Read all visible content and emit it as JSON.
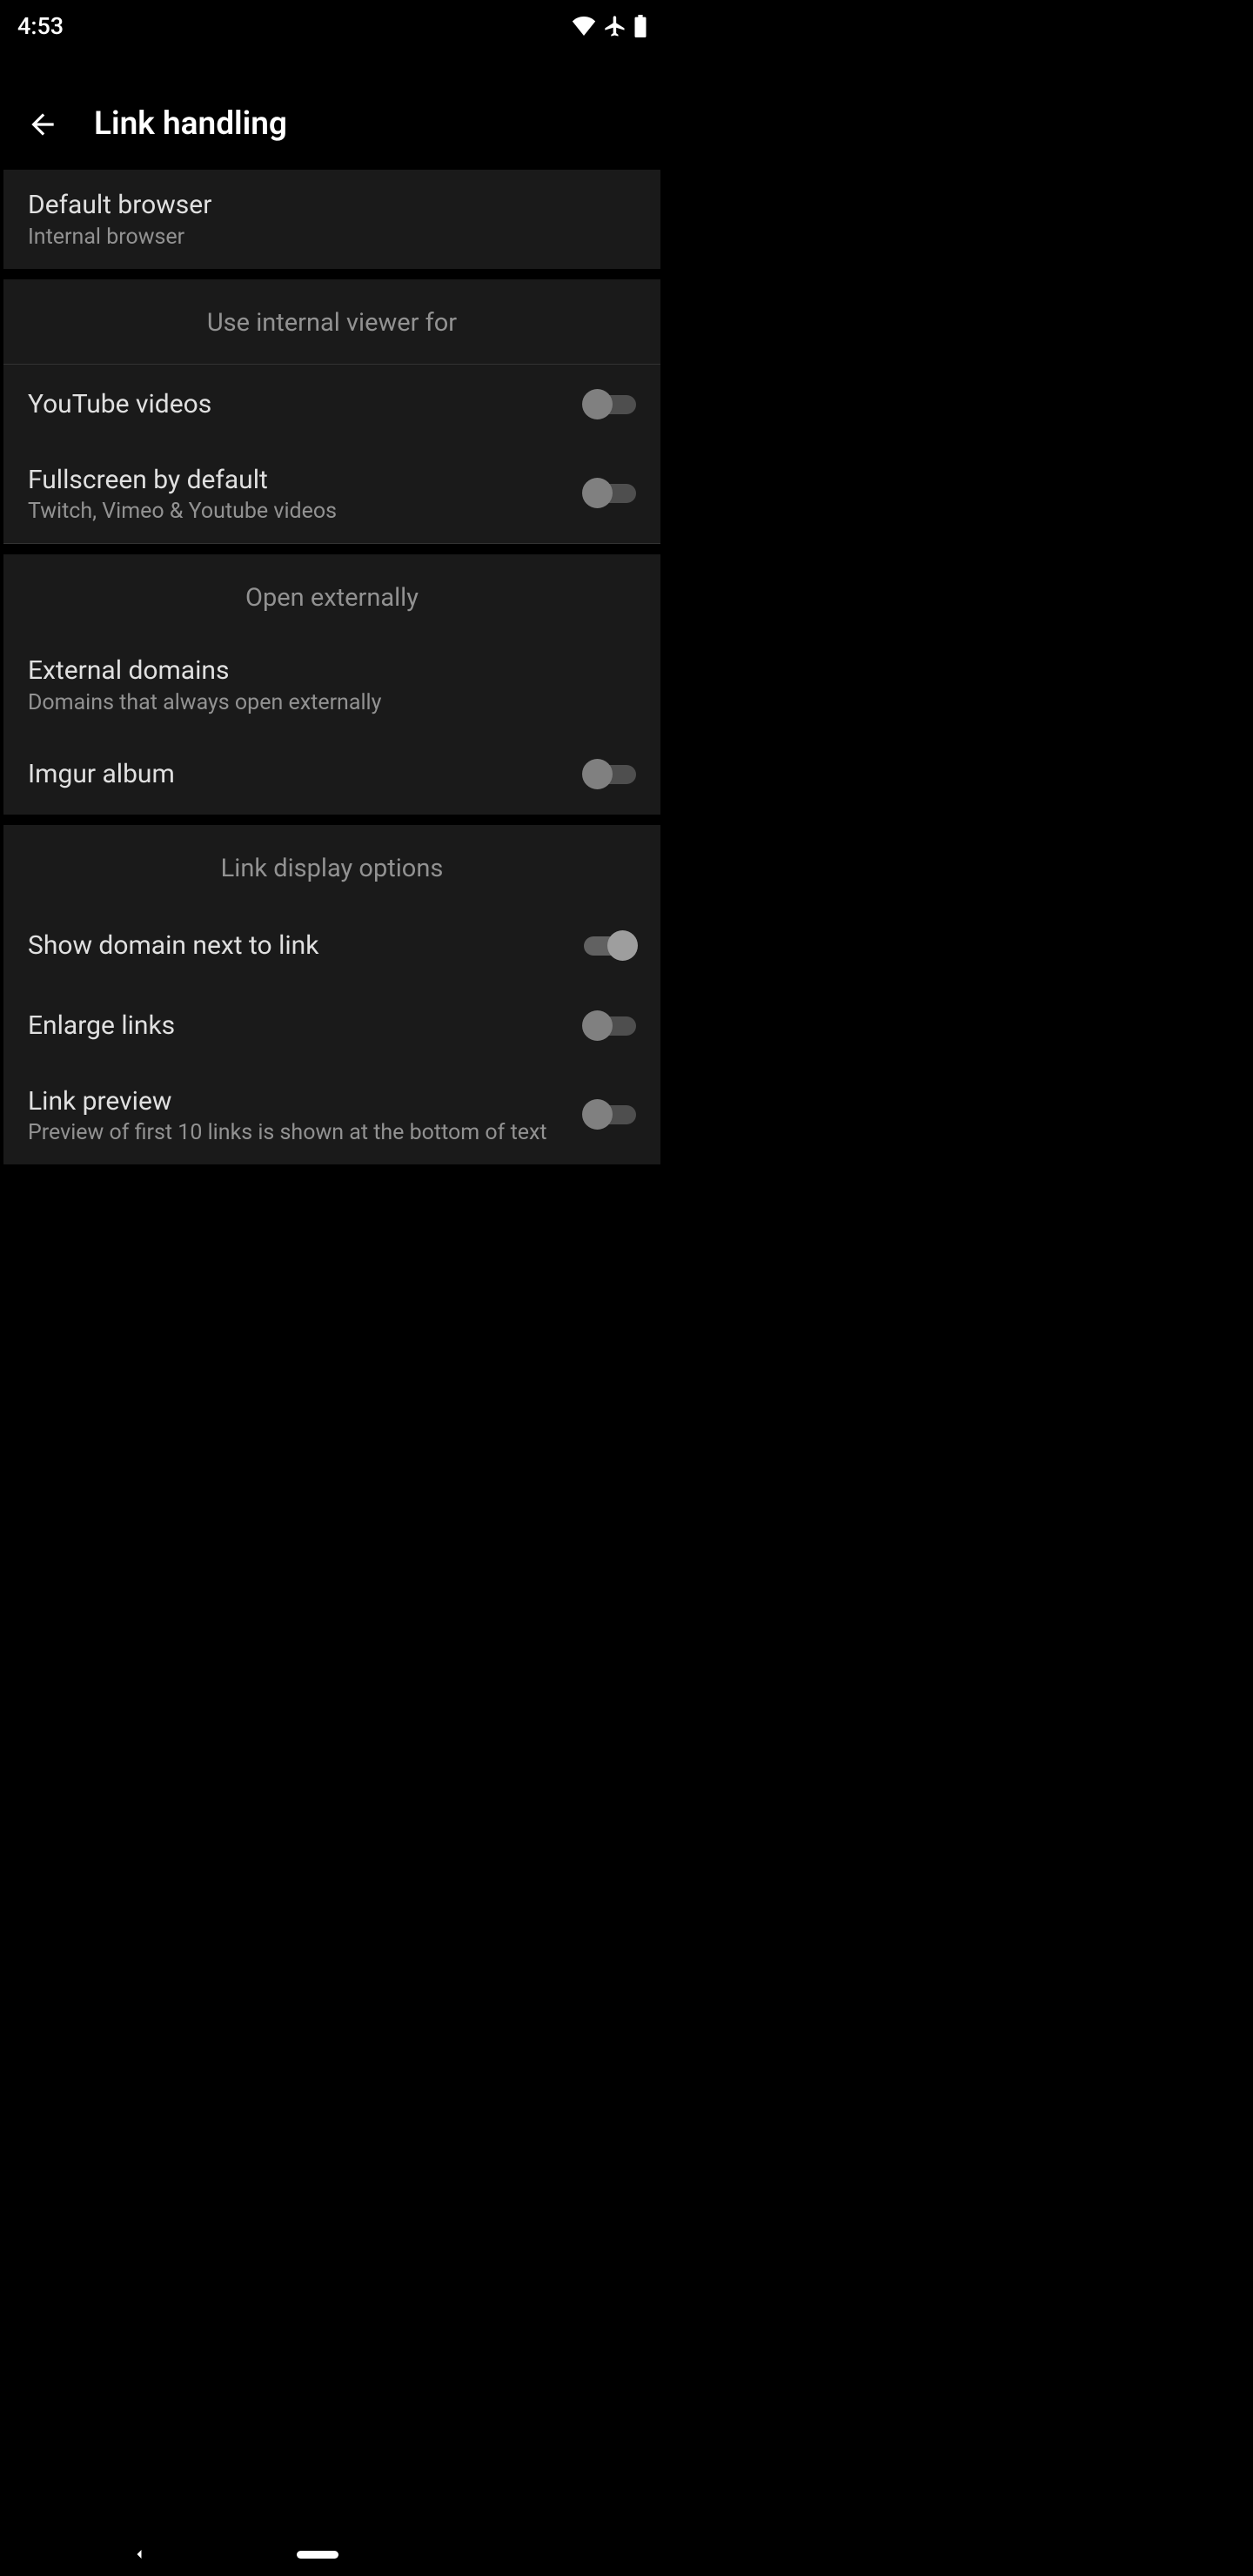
{
  "statusBar": {
    "time": "4:53"
  },
  "toolbar": {
    "title": "Link handling"
  },
  "sections": {
    "defaultBrowser": {
      "title": "Default browser",
      "subtitle": "Internal browser"
    },
    "internalViewer": {
      "header": "Use internal viewer for",
      "youtube": {
        "title": "YouTube videos"
      },
      "fullscreen": {
        "title": "Fullscreen by default",
        "subtitle": "Twitch, Vimeo & Youtube videos"
      }
    },
    "openExternally": {
      "header": "Open externally",
      "externalDomains": {
        "title": "External domains",
        "subtitle": "Domains that always open externally"
      },
      "imgurAlbum": {
        "title": "Imgur album"
      }
    },
    "linkDisplay": {
      "header": "Link display options",
      "showDomain": {
        "title": "Show domain next to link"
      },
      "enlargeLinks": {
        "title": "Enlarge links"
      },
      "linkPreview": {
        "title": "Link preview",
        "subtitle": "Preview of first 10 links is shown at the bottom of text"
      }
    }
  }
}
